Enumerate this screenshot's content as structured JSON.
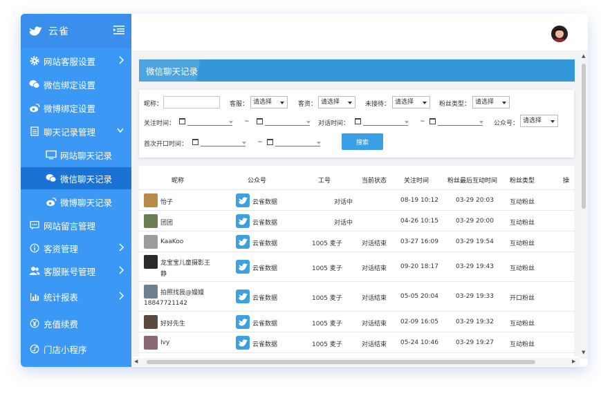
{
  "app": {
    "name": "云雀"
  },
  "sidebar": {
    "items": [
      {
        "label": "网站客服设置",
        "icon": "gear-icon"
      },
      {
        "label": "微信绑定设置",
        "icon": "wechat-icon"
      },
      {
        "label": "微博绑定设置",
        "icon": "weibo-icon"
      },
      {
        "label": "聊天记录管理",
        "icon": "document-icon"
      },
      {
        "label": "网站聊天记录",
        "icon": "monitor-icon"
      },
      {
        "label": "微信聊天记录",
        "icon": "wechat-icon"
      },
      {
        "label": "微博聊天记录",
        "icon": "weibo-icon"
      },
      {
        "label": "网站留言管理",
        "icon": "message-icon"
      },
      {
        "label": "客资管理",
        "icon": "info-icon"
      },
      {
        "label": "客服账号管理",
        "icon": "users-icon"
      },
      {
        "label": "统计报表",
        "icon": "bar-chart-icon"
      },
      {
        "label": "充值续费",
        "icon": "yen-icon"
      },
      {
        "label": "门店小程序",
        "icon": "miniprogram-icon"
      }
    ]
  },
  "page": {
    "title": "微信聊天记录"
  },
  "filters": {
    "nickname_label": "昵称：",
    "nickname_value": "",
    "service_label": "客服：",
    "client_label": "客资：",
    "pending_label": "未接待：",
    "fan_type_label": "粉丝类型：",
    "follow_time_label": "关注时间：",
    "chat_time_label": "对话时间：",
    "official_label": "公众号：",
    "first_talk_label": "首次开口时间：",
    "range_sep": "~",
    "select_placeholder": "请选择",
    "search_button": "搜索"
  },
  "table": {
    "headers": [
      "昵称",
      "公众号",
      "工号",
      "当前状态",
      "关注时间",
      "粉丝最后互动时间",
      "粉丝类型",
      "操"
    ],
    "rows": [
      {
        "nickname": "怡子",
        "nickname2": "",
        "official": "云雀数据",
        "staff": "",
        "status": "对话中",
        "follow": "08-19 10:12",
        "last": "03-29 20:03",
        "type": "互动粉丝"
      },
      {
        "nickname": "团团",
        "nickname2": "",
        "official": "云雀数据",
        "staff": "",
        "status": "对话中",
        "follow": "04-26 10:15",
        "last": "03-29 20:00",
        "type": "互动粉丝"
      },
      {
        "nickname": "KaaKoo",
        "nickname2": "",
        "official": "云雀数据",
        "staff": "1005 麦子",
        "status": "对话结束",
        "follow": "03-27 16:09",
        "last": "03-29 19:54",
        "type": "互动粉丝"
      },
      {
        "nickname": "龙宝宝儿童摄影王",
        "nickname2": "静",
        "official": "云雀数据",
        "staff": "1005 麦子",
        "status": "对话结束",
        "follow": "09-20 18:17",
        "last": "03-29 19:43",
        "type": "互动粉丝"
      },
      {
        "nickname": "拍照找我@嫚嫚",
        "nickname2": "18847721142",
        "official": "云雀数据",
        "staff": "1005 麦子",
        "status": "对话结束",
        "follow": "05-05 20:04",
        "last": "03-29 19:33",
        "type": "开口粉丝"
      },
      {
        "nickname": "好好先生",
        "nickname2": "",
        "official": "云雀数据",
        "staff": "1005 麦子",
        "status": "对话结束",
        "follow": "02-09 16:05",
        "last": "03-29 19:32",
        "type": "互动粉丝"
      },
      {
        "nickname": "Ivy",
        "nickname2": "",
        "official": "云雀数据",
        "staff": "1005 麦子",
        "status": "对话结束",
        "follow": "05-24 10:46",
        "last": "03-29 19:27",
        "type": "互动粉丝"
      }
    ]
  },
  "colors": {
    "sidebar": "#3c98f5",
    "active": "#1a73d4",
    "title_bar": "#3497d9",
    "button": "#3aa0e6"
  }
}
